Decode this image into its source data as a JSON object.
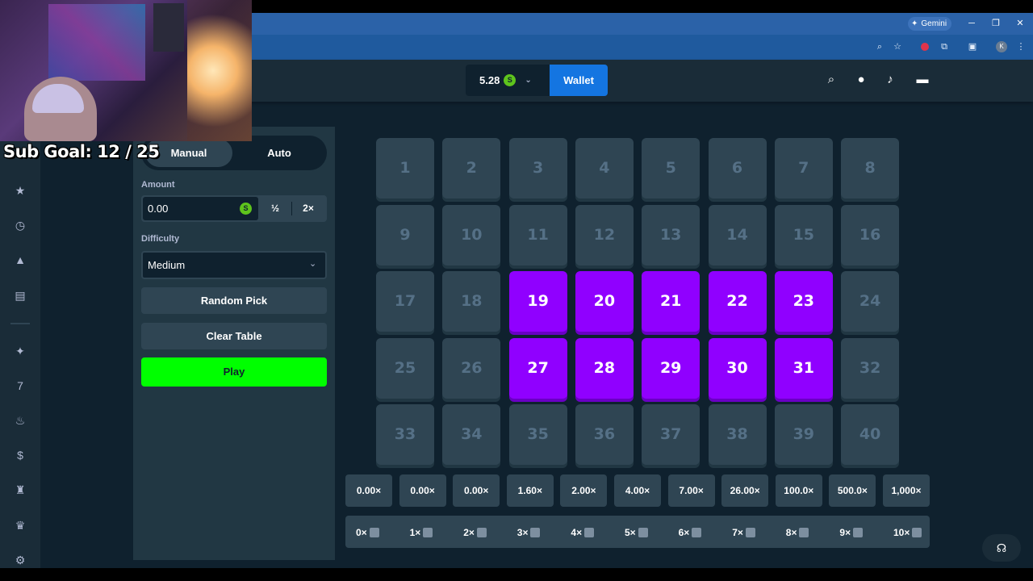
{
  "browser": {
    "gemini_label": "Gemini",
    "avatar_letter": "K"
  },
  "overlay": {
    "sub_goal": "Sub Goal:  12 / 25"
  },
  "header": {
    "balance": "5.28",
    "currency_symbol": "S",
    "wallet_label": "Wallet"
  },
  "controls": {
    "tabs": [
      {
        "label": "Manual",
        "active": true
      },
      {
        "label": "Auto",
        "active": false
      }
    ],
    "amount_label": "Amount",
    "amount_value": "0.00",
    "half_label": "½",
    "double_label": "2×",
    "difficulty_label": "Difficulty",
    "difficulty_value": "Medium",
    "random_pick_label": "Random Pick",
    "clear_table_label": "Clear Table",
    "play_label": "Play"
  },
  "board": {
    "tiles": [
      "1",
      "2",
      "3",
      "4",
      "5",
      "6",
      "7",
      "8",
      "9",
      "10",
      "11",
      "12",
      "13",
      "14",
      "15",
      "16",
      "17",
      "18",
      "19",
      "20",
      "21",
      "22",
      "23",
      "24",
      "25",
      "26",
      "27",
      "28",
      "29",
      "30",
      "31",
      "32",
      "33",
      "34",
      "35",
      "36",
      "37",
      "38",
      "39",
      "40"
    ],
    "selected": [
      "19",
      "20",
      "21",
      "22",
      "23",
      "27",
      "28",
      "29",
      "30",
      "31"
    ],
    "multipliers": [
      "0.00×",
      "0.00×",
      "0.00×",
      "1.60×",
      "2.00×",
      "4.00×",
      "7.00×",
      "26.00×",
      "100.0×",
      "500.0×",
      "1,000×"
    ],
    "hits": [
      "0×",
      "1×",
      "2×",
      "3×",
      "4×",
      "5×",
      "6×",
      "7×",
      "8×",
      "9×",
      "10×"
    ]
  },
  "colors": {
    "selected_tile": "#9000ff",
    "play_button": "#00ff00",
    "wallet_button": "#1475e1"
  }
}
